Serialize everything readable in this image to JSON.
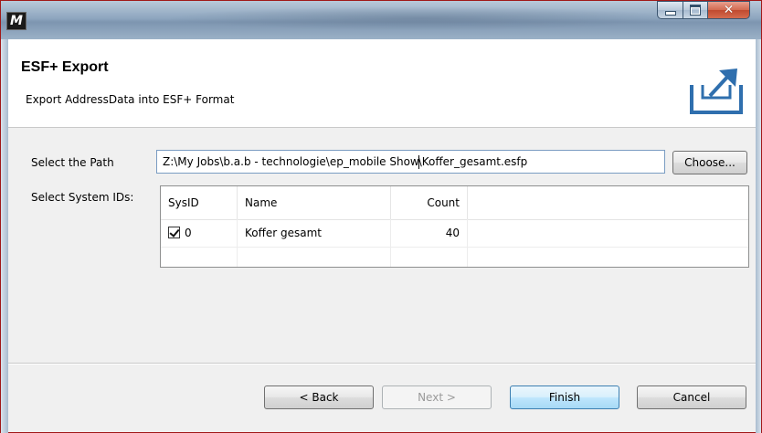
{
  "window": {
    "app_icon": "M"
  },
  "header": {
    "title": "ESF+ Export",
    "description": "Export AddressData into ESF+ Format",
    "icon": "export-icon"
  },
  "form": {
    "path_label": "Select the Path",
    "path_value_before_caret": "Z:\\My Jobs\\b.a.b - technologie\\ep_mobile Show",
    "path_value_after_caret": "\\Koffer_gesamt.esfp",
    "choose_label": "Choose...",
    "sysids_label": "Select System IDs:"
  },
  "table": {
    "columns": [
      "SysID",
      "Name",
      "Count"
    ],
    "rows": [
      {
        "sysid": "0",
        "name": "Koffer gesamt",
        "count": "40",
        "checked": true
      }
    ]
  },
  "buttons": {
    "back": "< Back",
    "next": "Next >",
    "finish": "Finish",
    "cancel": "Cancel"
  }
}
